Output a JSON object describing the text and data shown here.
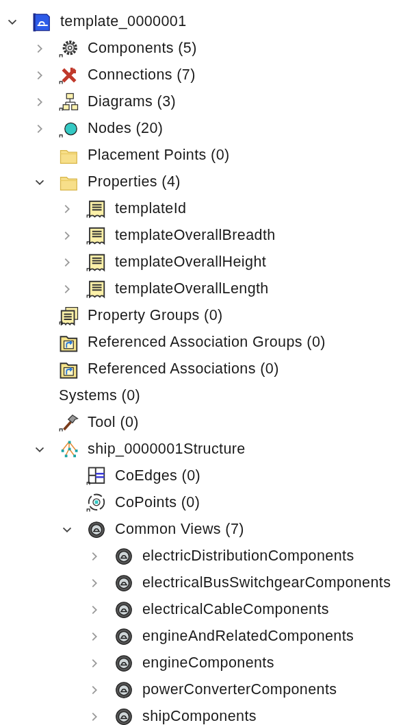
{
  "tree": [
    {
      "label": "template_0000001",
      "kind": "template",
      "expanded": true,
      "children": [
        {
          "label": "Components (5)",
          "kind": "gear",
          "expanded": false
        },
        {
          "label": "Connections (7)",
          "kind": "connections",
          "expanded": false
        },
        {
          "label": "Diagrams (3)",
          "kind": "diagram",
          "expanded": false
        },
        {
          "label": "Nodes (20)",
          "kind": "node",
          "expanded": false
        },
        {
          "label": "Placement Points (0)",
          "kind": "folder"
        },
        {
          "label": "Properties (4)",
          "kind": "folder",
          "expanded": true,
          "children": [
            {
              "label": "templateId",
              "kind": "property",
              "expanded": false
            },
            {
              "label": "templateOverallBreadth",
              "kind": "property",
              "expanded": false
            },
            {
              "label": "templateOverallHeight",
              "kind": "property",
              "expanded": false
            },
            {
              "label": "templateOverallLength",
              "kind": "property",
              "expanded": false
            }
          ]
        },
        {
          "label": "Property Groups (0)",
          "kind": "property-group"
        },
        {
          "label": "Referenced Association Groups (0)",
          "kind": "association-folder"
        },
        {
          "label": "Referenced Associations (0)",
          "kind": "association-folder"
        },
        {
          "label": "Systems (0)",
          "kind": "none"
        },
        {
          "label": "Tool (0)",
          "kind": "hammer"
        },
        {
          "label": "ship_0000001Structure",
          "kind": "structure",
          "expanded": true,
          "children": [
            {
              "label": "CoEdges (0)",
              "kind": "coedges"
            },
            {
              "label": "CoPoints (0)",
              "kind": "copoints"
            },
            {
              "label": "Common Views (7)",
              "kind": "view",
              "expanded": true,
              "children": [
                {
                  "label": "electricDistributionComponents",
                  "kind": "view",
                  "expanded": false
                },
                {
                  "label": "electricalBusSwitchgearComponents",
                  "kind": "view",
                  "expanded": false
                },
                {
                  "label": "electricalCableComponents",
                  "kind": "view",
                  "expanded": false
                },
                {
                  "label": "engineAndRelatedComponents",
                  "kind": "view",
                  "expanded": false
                },
                {
                  "label": "engineComponents",
                  "kind": "view",
                  "expanded": false
                },
                {
                  "label": "powerConverterComponents",
                  "kind": "view",
                  "expanded": false
                },
                {
                  "label": "shipComponents",
                  "kind": "view",
                  "expanded": false
                }
              ]
            }
          ]
        }
      ]
    }
  ]
}
